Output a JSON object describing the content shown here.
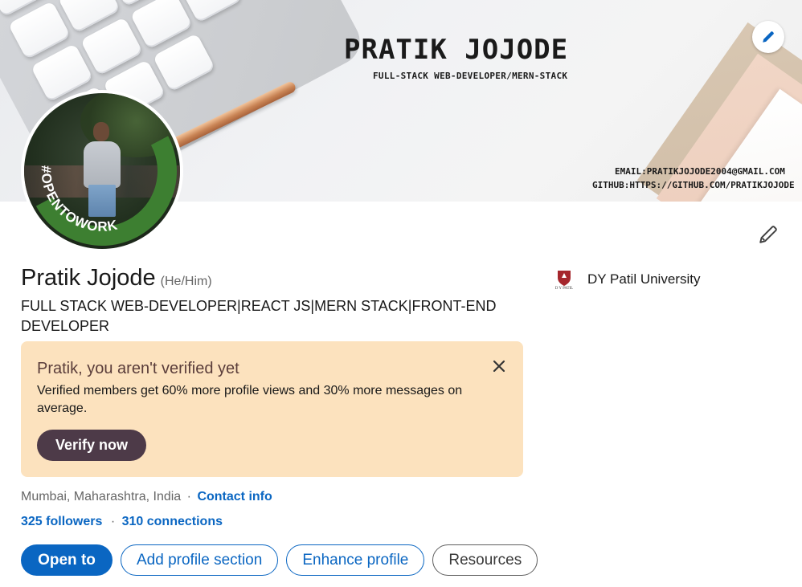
{
  "cover": {
    "title": "PRATIK JOJODE",
    "subtitle": "FULL-STACK WEB-DEVELOPER/MERN-STACK",
    "email": "EMAIL:PRATIKJOJODE2004@GMAIL.COM",
    "github": "GITHUB:HTTPS://GITHUB.COM/PRATIKJOJODE",
    "edit_icon": "pencil-icon"
  },
  "avatar": {
    "frame_text": "#OPENTOWORK",
    "frame_color": "#3d7f31"
  },
  "profile": {
    "name": "Pratik Jojode",
    "pronouns": "(He/Him)",
    "headline": "FULL STACK WEB-DEVELOPER|REACT JS|MERN STACK|FRONT-END DEVELOPER",
    "edit_icon": "pencil-icon"
  },
  "education": {
    "school_name": "DY Patil University",
    "logo_text": "D Y PATIL"
  },
  "verify_card": {
    "title": "Pratik, you aren't verified yet",
    "text": "Verified members get 60% more profile views and 30% more messages on average.",
    "button_label": "Verify now",
    "close_icon": "close-icon",
    "background": "#fce2be",
    "button_color": "#4d3a48"
  },
  "meta": {
    "location": "Mumbai, Maharashtra, India",
    "separator": "·",
    "contact_label": "Contact info",
    "followers": "325 followers",
    "connections": "310 connections"
  },
  "actions": {
    "open_to": "Open to",
    "add_section": "Add profile section",
    "enhance": "Enhance profile",
    "resources": "Resources"
  },
  "colors": {
    "accent": "#0a66c2",
    "text_secondary": "#666666"
  }
}
